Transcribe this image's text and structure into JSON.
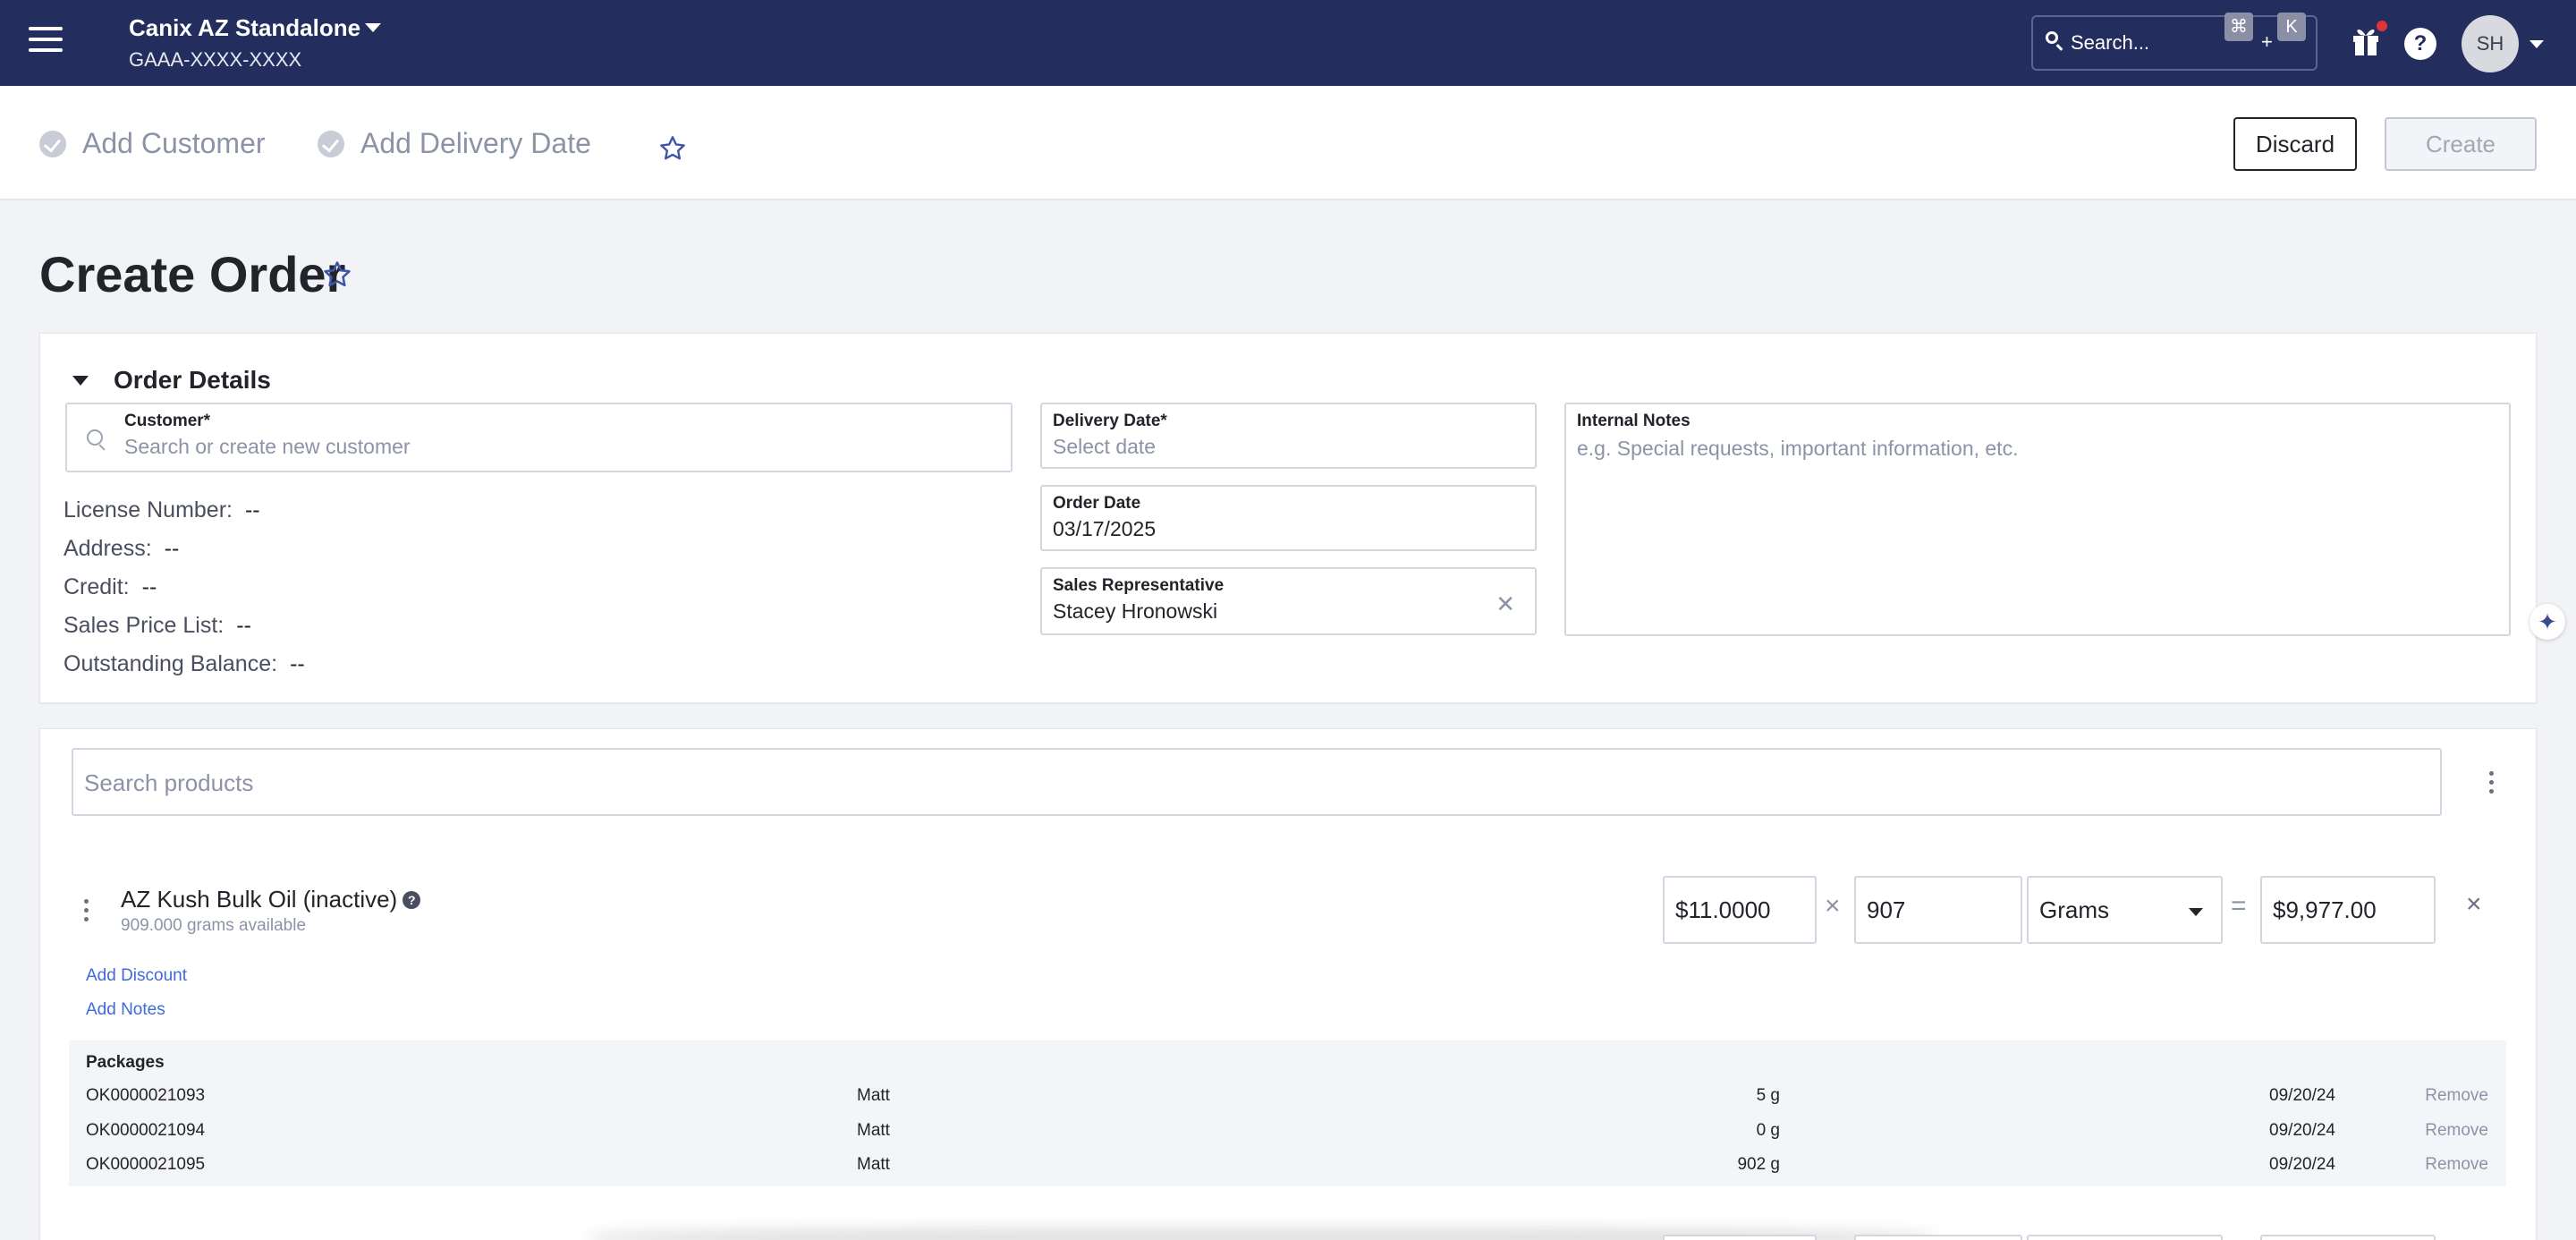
{
  "topbar": {
    "tenant_name": "Canix AZ Standalone",
    "tenant_license": "GAAA-XXXX-XXXX",
    "search_placeholder": "Search...",
    "shortcut_mod": "⌘",
    "shortcut_plus": "+",
    "shortcut_key": "K",
    "help_label": "?",
    "user_initials": "SH"
  },
  "steps": {
    "add_customer": "Add Customer",
    "add_delivery_date": "Add Delivery Date"
  },
  "actions": {
    "discard": "Discard",
    "create": "Create"
  },
  "page": {
    "title": "Create Order"
  },
  "order_details": {
    "section_title": "Order Details",
    "customer_label": "Customer*",
    "customer_placeholder": "Search or create new customer",
    "delivery_label": "Delivery Date*",
    "delivery_placeholder": "Select date",
    "order_date_label": "Order Date",
    "order_date_value": "03/17/2025",
    "sales_rep_label": "Sales Representative",
    "sales_rep_value": "Stacey Hronowski",
    "notes_label": "Internal Notes",
    "notes_placeholder": "e.g. Special requests, important information, etc.",
    "info": [
      {
        "label": "License Number:",
        "value": "--"
      },
      {
        "label": "Address:",
        "value": "--"
      },
      {
        "label": "Credit:",
        "value": "--"
      },
      {
        "label": "Sales Price List:",
        "value": "--"
      },
      {
        "label": "Outstanding Balance:",
        "value": "--"
      }
    ]
  },
  "products": {
    "search_placeholder": "Search products",
    "item": {
      "name": "AZ Kush Bulk Oil (inactive)",
      "availability": "909.000 grams available",
      "price": "$11.0000",
      "quantity": "907",
      "unit": "Grams",
      "total": "$9,977.00",
      "times_symbol": "×",
      "equals_symbol": "=",
      "remove_symbol": "×",
      "add_discount": "Add Discount",
      "add_notes": "Add Notes"
    },
    "packages_title": "Packages",
    "packages": [
      {
        "tag": "OK0000021093",
        "owner": "Matt",
        "qty": "5 g",
        "date": "09/20/24",
        "action": "Remove"
      },
      {
        "tag": "OK0000021094",
        "owner": "Matt",
        "qty": "0 g",
        "date": "09/20/24",
        "action": "Remove"
      },
      {
        "tag": "OK0000021095",
        "owner": "Matt",
        "qty": "902 g",
        "date": "09/20/24",
        "action": "Remove"
      }
    ]
  },
  "icons": {
    "menu": "hamburger-icon",
    "search": "search-icon",
    "gift": "gift-icon",
    "help": "help-icon",
    "favorite": "star-outline-icon",
    "assistant": "sparkle-icon"
  },
  "colors": {
    "topbar_bg": "#232e5f",
    "link": "#3f6ad8",
    "notification_dot": "#e0343b"
  }
}
